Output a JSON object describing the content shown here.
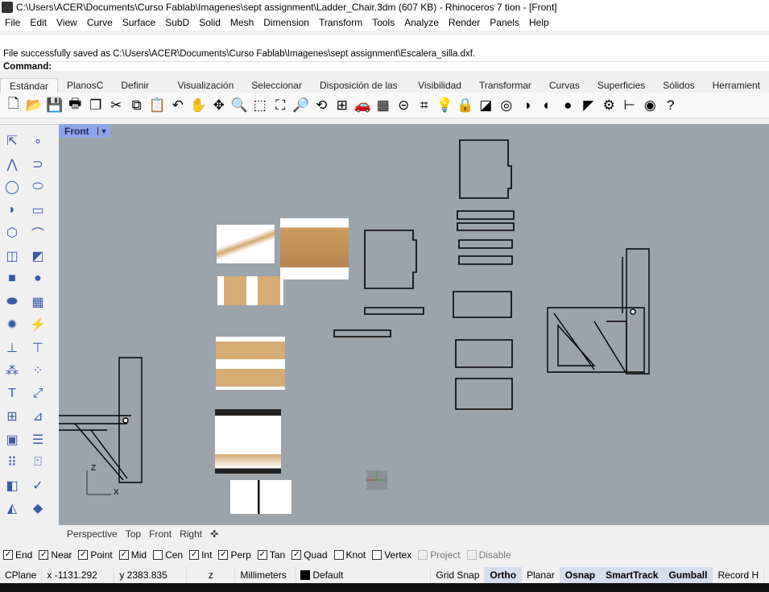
{
  "window": {
    "title": "C:\\Users\\ACER\\Documents\\Curso Fablab\\Imagenes\\sept assignment\\Ladder_Chair.3dm (607 KB) - Rhinoceros 7 tion - [Front]"
  },
  "menu": [
    "File",
    "Edit",
    "View",
    "Curve",
    "Surface",
    "SubD",
    "Solid",
    "Mesh",
    "Dimension",
    "Transform",
    "Tools",
    "Analyze",
    "Render",
    "Panels",
    "Help"
  ],
  "command": {
    "message": "File successfully saved as C:\\Users\\ACER\\Documents\\Curso Fablab\\Imagenes\\sept assignment\\Escalera_silla.dxf.",
    "prompt": "Command:",
    "value": ""
  },
  "toolbar_tabs": [
    "Estándar",
    "PlanosC",
    "Definir vista",
    "Visualización",
    "Seleccionar",
    "Disposición de las vistas",
    "Visibilidad",
    "Transformar",
    "Curvas",
    "Superficies",
    "Sólidos",
    "Herramient"
  ],
  "toolbar_icons": [
    [
      "new-icon",
      "🗋"
    ],
    [
      "open-icon",
      "📂"
    ],
    [
      "save-icon",
      "💾"
    ],
    [
      "print-icon",
      "🖶"
    ],
    [
      "import-icon",
      "❐"
    ],
    [
      "cut-icon",
      "✂"
    ],
    [
      "copy-icon",
      "⧉"
    ],
    [
      "paste-icon",
      "📋"
    ],
    [
      "undo-icon",
      "↶"
    ],
    [
      "pan-icon",
      "✋"
    ],
    [
      "rotate-view-icon",
      "✥"
    ],
    [
      "zoom-icon",
      "🔍"
    ],
    [
      "zoom-window-icon",
      "⬚"
    ],
    [
      "zoom-extents-icon",
      "⛶"
    ],
    [
      "zoom-selected-icon",
      "🔎"
    ],
    [
      "rotate-icon",
      "⟲"
    ],
    [
      "viewports-icon",
      "⊞"
    ],
    [
      "car-icon",
      "🚗"
    ],
    [
      "grid-icon",
      "▦"
    ],
    [
      "cplane-icon",
      "⊝"
    ],
    [
      "snap-icon",
      "⌗"
    ],
    [
      "light-icon",
      "💡"
    ],
    [
      "lock-icon",
      "🔒"
    ],
    [
      "layer-icon",
      "◪"
    ],
    [
      "color-wheel-icon",
      "◎"
    ],
    [
      "shaded-sphere-icon",
      "◑"
    ],
    [
      "rendered-sphere-icon",
      "◐"
    ],
    [
      "blue-sphere-icon",
      "●"
    ],
    [
      "pointer-icon",
      "◤"
    ],
    [
      "gear-icon",
      "⚙"
    ],
    [
      "dimension-icon",
      "⊢"
    ],
    [
      "globe-icon",
      "◉"
    ],
    [
      "help-icon",
      "?"
    ]
  ],
  "left_tools": [
    [
      "select-icon",
      "⇱"
    ],
    [
      "point-icon",
      "∘"
    ],
    [
      "polyline-icon",
      "⋀"
    ],
    [
      "curve-icon",
      "⊃"
    ],
    [
      "circle-icon",
      "◯"
    ],
    [
      "ellipse-icon",
      "⬭"
    ],
    [
      "arc-icon",
      "◗"
    ],
    [
      "rectangle-icon",
      "▭"
    ],
    [
      "polygon-icon",
      "⬡"
    ],
    [
      "fillet-icon",
      "⌒"
    ],
    [
      "surface-icon",
      "◫"
    ],
    [
      "surface-edge-icon",
      "◩"
    ],
    [
      "box-icon",
      "■"
    ],
    [
      "sphere-icon",
      "●"
    ],
    [
      "cylinder-icon",
      "⬬"
    ],
    [
      "mesh-icon",
      "▦"
    ],
    [
      "explode-icon",
      "✹"
    ],
    [
      "boolean-icon",
      "⚡"
    ],
    [
      "split-icon",
      "⊥"
    ],
    [
      "trim-icon",
      "⊤"
    ],
    [
      "group-icon",
      "⁂"
    ],
    [
      "points-icon",
      "⁘"
    ],
    [
      "text-icon",
      "T"
    ],
    [
      "transform-icon",
      "⤢"
    ],
    [
      "array-icon",
      "⊞"
    ],
    [
      "dim-icon",
      "⊿"
    ],
    [
      "block-icon",
      "▣"
    ],
    [
      "layout-icon",
      "☰"
    ],
    [
      "grid-points-icon",
      "⠿"
    ],
    [
      "cage-icon",
      "⍐"
    ],
    [
      "analyze-icon",
      "◧"
    ],
    [
      "check-icon",
      "✓"
    ],
    [
      "render-icon",
      "◭"
    ],
    [
      "material-icon",
      "◆"
    ]
  ],
  "viewport": {
    "name": "Front",
    "axis_x": "X",
    "axis_z": "Z"
  },
  "viewport_tabs": [
    "Perspective",
    "Top",
    "Front",
    "Right"
  ],
  "osnaps": [
    {
      "label": "End",
      "checked": true
    },
    {
      "label": "Near",
      "checked": true
    },
    {
      "label": "Point",
      "checked": true
    },
    {
      "label": "Mid",
      "checked": true
    },
    {
      "label": "Cen",
      "checked": false
    },
    {
      "label": "Int",
      "checked": true
    },
    {
      "label": "Perp",
      "checked": true
    },
    {
      "label": "Tan",
      "checked": true
    },
    {
      "label": "Quad",
      "checked": true
    },
    {
      "label": "Knot",
      "checked": false
    },
    {
      "label": "Vertex",
      "checked": false
    },
    {
      "label": "Project",
      "checked": false,
      "disabled": true
    },
    {
      "label": "Disable",
      "checked": false,
      "disabled": true
    }
  ],
  "status": {
    "cplane": "CPlane",
    "x": "x -1131.292",
    "y": "y 2383.835",
    "z": "z",
    "units": "Millimeters",
    "layer": "Default",
    "grid_snap": "Grid Snap",
    "ortho": "Ortho",
    "planar": "Planar",
    "osnap": "Osnap",
    "smarttrack": "SmartTrack",
    "gumball": "Gumball",
    "record": "Record H"
  },
  "colors": {
    "viewport_bg": "#9ba3ab",
    "viewport_label": "#8fa4e8",
    "active_toggle": "#d5deef"
  }
}
